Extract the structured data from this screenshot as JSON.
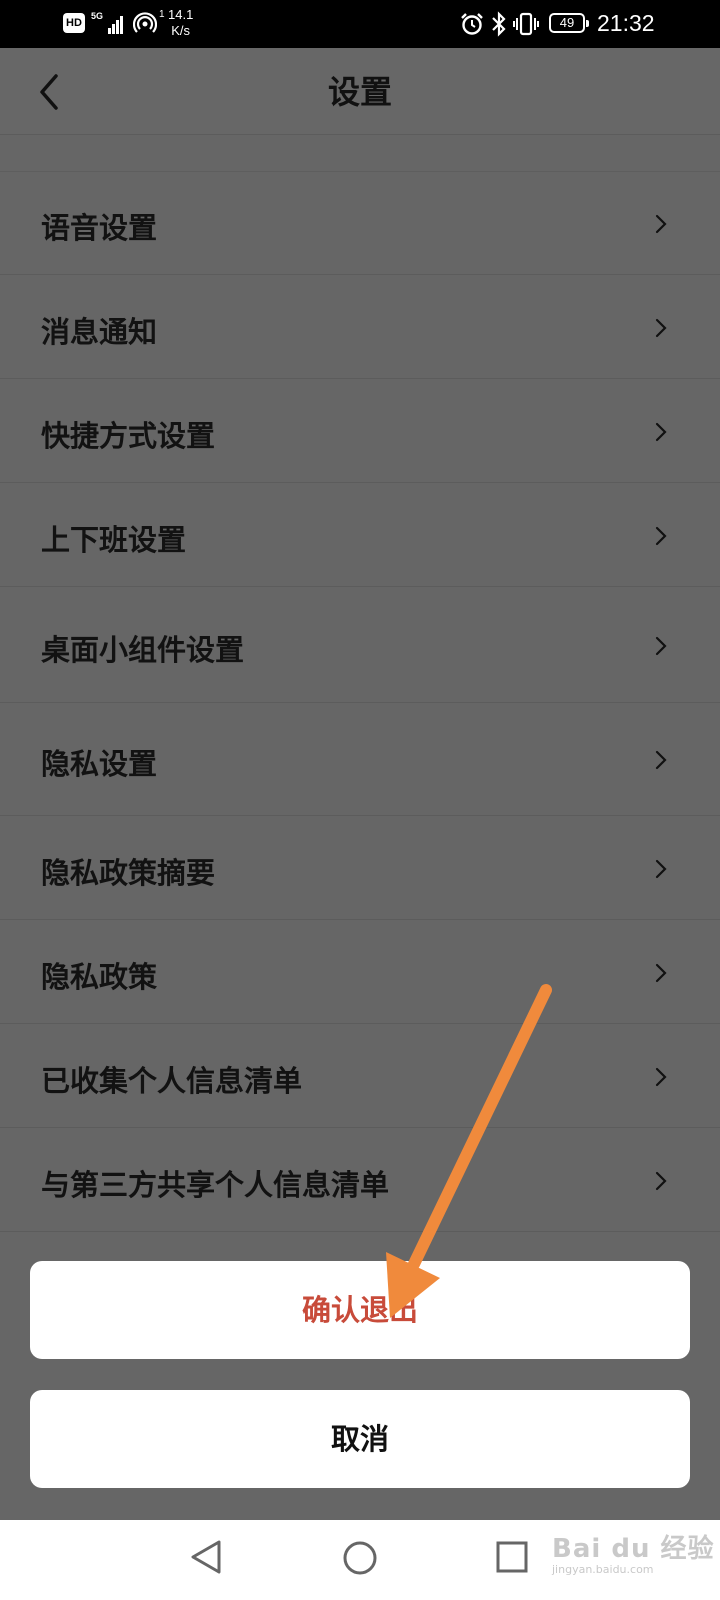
{
  "status_bar": {
    "hd": "HD",
    "network": "5G",
    "hotspot_count": "1",
    "speed_value": "14.1",
    "speed_unit": "K/s",
    "battery": "49",
    "time": "21:32"
  },
  "header": {
    "title": "设置"
  },
  "settings_items": [
    {
      "label": "语音设置"
    },
    {
      "label": "消息通知"
    },
    {
      "label": "快捷方式设置"
    },
    {
      "label": "上下班设置"
    },
    {
      "label": "桌面小组件设置"
    },
    {
      "label": "隐私设置"
    },
    {
      "label": "隐私政策摘要"
    },
    {
      "label": "隐私政策"
    },
    {
      "label": "已收集个人信息清单"
    },
    {
      "label": "与第三方共享个人信息清单"
    }
  ],
  "dialog": {
    "confirm_label": "确认退出",
    "cancel_label": "取消"
  },
  "watermark": {
    "main": "Bai du 经验",
    "sub": "jingyan.baidu.com"
  },
  "colors": {
    "confirm_text": "#c84b3a",
    "overlay": "#666666",
    "arrow": "#f08a3c"
  }
}
